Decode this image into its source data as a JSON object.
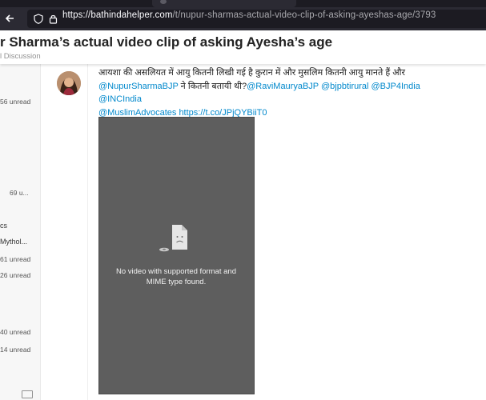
{
  "browser": {
    "url_domain": "https://bathindahelper.com",
    "url_path": "/t/nupur-sharmas-actual-video-clip-of-asking-ayeshas-age/3793"
  },
  "topic": {
    "title": "r Sharma’s actual video clip of asking Ayesha’s age",
    "category": "l Discussion"
  },
  "sidebar": {
    "items": [
      {
        "label": "56 unread"
      },
      {
        "label": "69 u..."
      },
      {
        "label": "cs"
      },
      {
        "label": "Mythol..."
      },
      {
        "label": "61 unread"
      },
      {
        "label": "26 unread"
      },
      {
        "label": "40 unread"
      },
      {
        "label": "14 unread"
      }
    ]
  },
  "post": {
    "line1": "आयशा की असलियत में आयु कितनी लिखी गई है कुरान में और मुसलिम कितनी आयु मानते हैं और",
    "mention1": "@NupurSharmaBJP",
    "line2_text": " ने कितनी बतायी थी?",
    "mentions2": "@RaviMauryaBJP @bjpbtirural @BJP4India @INCIndia",
    "mention3": "@MuslimAdvocates",
    "link": "https://t.co/JPjQYBiiT0",
    "video_error": "No video with supported format and MIME type found."
  },
  "icons": {
    "back": "back-arrow-icon",
    "shield": "tracking-shield-icon",
    "lock": "lock-icon",
    "broken_file": "sad-file-icon",
    "keyboard": "keyboard-icon"
  },
  "colors": {
    "link": "#0088cc",
    "video_bg": "#5e5e5e",
    "browser_bg": "#2b2a33"
  }
}
